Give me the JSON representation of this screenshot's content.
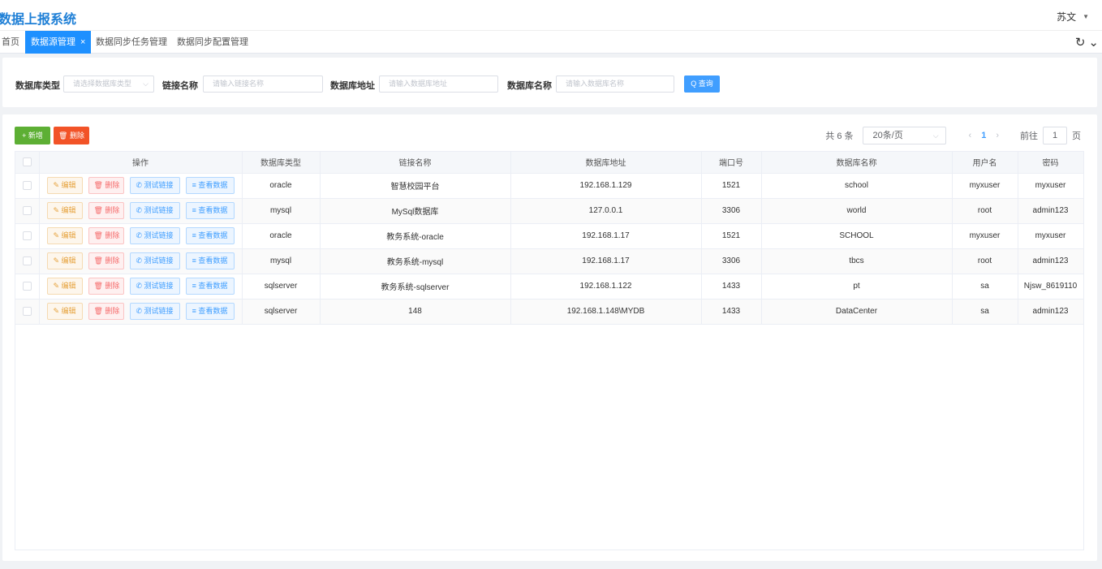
{
  "header": {
    "title": "数据上报系统",
    "user_name": "苏文",
    "user_caret": "▼"
  },
  "tabs": [
    {
      "label": "首页"
    },
    {
      "label": "数据源管理",
      "close": "×"
    },
    {
      "label": "数据同步任务管理"
    },
    {
      "label": "数据同步配置管理"
    }
  ],
  "tab_tools": {
    "refresh": "↻",
    "expand": "⌄"
  },
  "search": {
    "db_type_label": "数据库类型",
    "db_type_placeholder": "请选择数据库类型",
    "link_name_label": "链接名称",
    "link_name_placeholder": "请输入链接名称",
    "db_addr_label": "数据库地址",
    "db_addr_placeholder": "请输入数据库地址",
    "db_name_label": "数据库名称",
    "db_name_placeholder": "请输入数据库名称",
    "query_label": "Q 查询"
  },
  "toolbar": {
    "add_label": "+ 新增",
    "delete_label": "🗑 删除"
  },
  "pager": {
    "total": "共 6 条",
    "page_size": "20条/页",
    "prev": "‹",
    "current": "1",
    "next": "›",
    "goto_prefix": "前往",
    "goto_value": "1",
    "goto_suffix": "页"
  },
  "table": {
    "headers": [
      "操作",
      "数据库类型",
      "链接名称",
      "数据库地址",
      "端口号",
      "数据库名称",
      "用户名",
      "密码"
    ],
    "actions": {
      "edit": "✎ 编辑",
      "delete": "🗑 删除",
      "test": "✆ 测试链接",
      "view": "≡ 查看数据"
    },
    "rows": [
      {
        "db_type": "oracle",
        "link_name": "智慧校园平台",
        "address": "192.168.1.129",
        "port": "1521",
        "db_name": "school",
        "user": "myxuser",
        "password": "myxuser"
      },
      {
        "db_type": "mysql",
        "link_name": "MySql数据库",
        "address": "127.0.0.1",
        "port": "3306",
        "db_name": "world",
        "user": "root",
        "password": "admin123"
      },
      {
        "db_type": "oracle",
        "link_name": "教务系统-oracle",
        "address": "192.168.1.17",
        "port": "1521",
        "db_name": "SCHOOL",
        "user": "myxuser",
        "password": "myxuser"
      },
      {
        "db_type": "mysql",
        "link_name": "教务系统-mysql",
        "address": "192.168.1.17",
        "port": "3306",
        "db_name": "tbcs",
        "user": "root",
        "password": "admin123"
      },
      {
        "db_type": "sqlserver",
        "link_name": "教务系统-sqlserver",
        "address": "192.168.1.122",
        "port": "1433",
        "db_name": "pt",
        "user": "sa",
        "password": "Njsw_8619110"
      },
      {
        "db_type": "sqlserver",
        "link_name": "148",
        "address": "192.168.1.148\\MYDB",
        "port": "1433",
        "db_name": "DataCenter",
        "user": "sa",
        "password": "admin123"
      }
    ]
  }
}
